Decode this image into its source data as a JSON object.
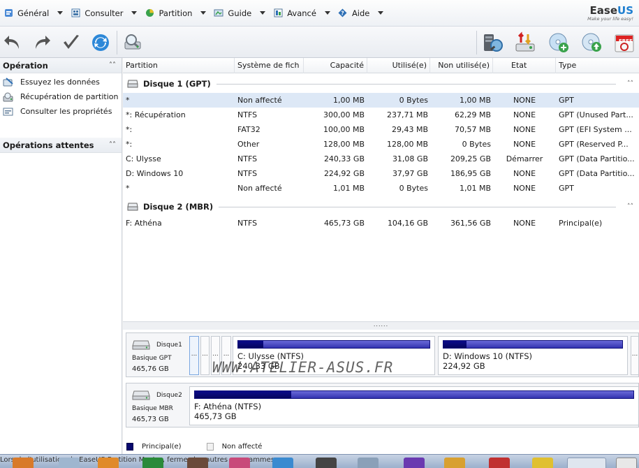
{
  "menu": {
    "items": [
      {
        "label": "Général",
        "icon": "general-icon"
      },
      {
        "label": "Consulter",
        "icon": "view-icon"
      },
      {
        "label": "Partition",
        "icon": "partition-icon"
      },
      {
        "label": "Guide",
        "icon": "guide-icon"
      },
      {
        "label": "Avancé",
        "icon": "advanced-icon"
      },
      {
        "label": "Aide",
        "icon": "help-icon"
      }
    ]
  },
  "logo": {
    "brand_a": "Ease",
    "brand_b": "US",
    "tagline": "Make your life easy!",
    "badge": "FREE"
  },
  "sidebar": {
    "operation_title": "Opération",
    "operation_items": [
      {
        "label": "Essuyez les données",
        "icon": "wipe-icon"
      },
      {
        "label": "Récupération de partition",
        "icon": "recovery-icon"
      },
      {
        "label": "Consulter les propriétés",
        "icon": "properties-icon"
      }
    ],
    "pending_title": "Opérations attentes"
  },
  "table": {
    "columns": [
      "Partition",
      "Système de fich",
      "Capacité",
      "Utilisé(e)",
      "Non utilisé(e)",
      "Etat",
      "Type"
    ],
    "groups": [
      {
        "label": "Disque 1 (GPT)",
        "rows": [
          [
            "*",
            "Non affecté",
            "1,00 MB",
            "0 Bytes",
            "1,00 MB",
            "NONE",
            "GPT"
          ],
          [
            "*: Récupération",
            "NTFS",
            "300,00 MB",
            "237,71 MB",
            "62,29 MB",
            "NONE",
            "GPT (Unused Part..."
          ],
          [
            "*:",
            "FAT32",
            "100,00 MB",
            "29,43 MB",
            "70,57 MB",
            "NONE",
            "GPT (EFI System ..."
          ],
          [
            "*:",
            "Other",
            "128,00 MB",
            "128,00 MB",
            "0 Bytes",
            "NONE",
            "GPT (Reserved P..."
          ],
          [
            "C: Ulysse",
            "NTFS",
            "240,33 GB",
            "31,08 GB",
            "209,25 GB",
            "Démarrer",
            "GPT (Data Partitio..."
          ],
          [
            "D: Windows 10",
            "NTFS",
            "224,92 GB",
            "37,97 GB",
            "186,95 GB",
            "NONE",
            "GPT (Data Partitio..."
          ],
          [
            "*",
            "Non affecté",
            "1,01 MB",
            "0 Bytes",
            "1,01 MB",
            "NONE",
            "GPT"
          ]
        ]
      },
      {
        "label": "Disque 2 (MBR)",
        "rows": [
          [
            "F: Athéna",
            "NTFS",
            "465,73 GB",
            "104,16 GB",
            "361,56 GB",
            "NONE",
            "Principal(e)"
          ]
        ]
      }
    ]
  },
  "splitter": {
    "handle": "......"
  },
  "diskmap": {
    "disk1": {
      "name": "Disque1",
      "type": "Basique GPT",
      "size": "465,76 GB",
      "small_dots": "...",
      "parts": [
        {
          "label": "C: Ulysse (NTFS)",
          "size": "240,33 GB",
          "used": 0.13
        },
        {
          "label": "D: Windows 10 (NTFS)",
          "size": "224,92 GB",
          "used": 0.13
        }
      ]
    },
    "disk2": {
      "name": "Disque2",
      "type": "Basique MBR",
      "size": "465,73 GB",
      "parts": [
        {
          "label": "F: Athéna (NTFS)",
          "size": "465,73 GB",
          "used": 0.22
        }
      ]
    }
  },
  "watermark": "WWW.ATELIER-ASUS.FR",
  "legend": {
    "primary": "Principal(e)",
    "unallocated": "Non affecté"
  },
  "status": {
    "text": "Lors de l'utilisation de EaseUS Partition Master, fermez les autres programmes."
  },
  "colors": {
    "accent": "#1f7fd0",
    "bar_dark": "#08086e",
    "bar_light": "#4a4ac4",
    "selection": "#dde8f6"
  }
}
